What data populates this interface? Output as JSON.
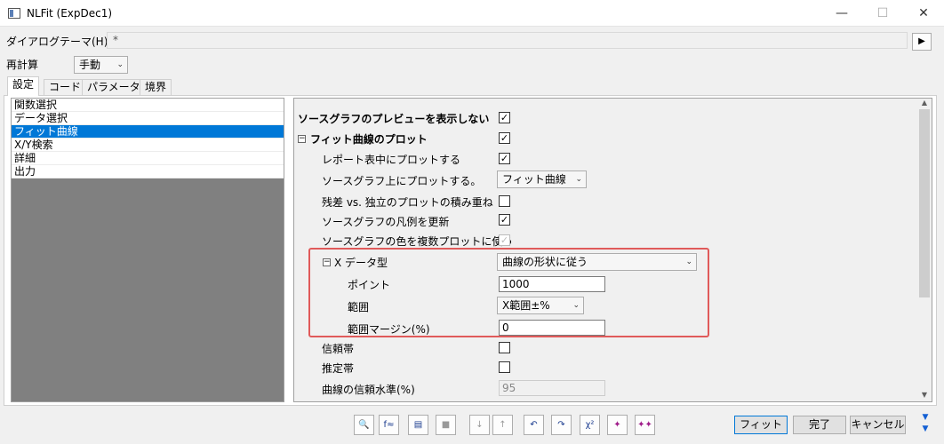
{
  "window": {
    "title": "NLFit (ExpDec1)",
    "minimize": "—",
    "maximize": "☐",
    "close": "✕"
  },
  "theme": {
    "label": "ダイアログテーマ(H)",
    "value": "*",
    "arrow": "▶"
  },
  "recalc": {
    "label": "再計算",
    "value": "手動"
  },
  "tabs": [
    "設定",
    "コード",
    "パラメータ",
    "境界"
  ],
  "left_list": [
    "関数選択",
    "データ選択",
    "フィット曲線",
    "X/Y検索",
    "詳細",
    "出力"
  ],
  "props": {
    "no_preview": "ソースグラフのプレビューを表示しない",
    "fit_plot": "フィット曲線のプロット",
    "plot_in_report": "レポート表中にプロットする",
    "plot_on_source": "ソースグラフ上にプロットする。",
    "plot_on_source_value": "フィット曲線",
    "stack_resid": "残差 vs. 独立のプロットの積み重ね",
    "update_legend": "ソースグラフの凡例を更新",
    "use_source_color": "ソースグラフの色を複数プロットに使う",
    "x_data_type": "X データ型",
    "x_data_type_value": "曲線の形状に従う",
    "points": "ポイント",
    "points_value": "1000",
    "range": "範囲",
    "range_value": "X範囲±%",
    "range_margin": "範囲マージン(%)",
    "range_margin_value": "0",
    "conf_band": "信頼帯",
    "pred_band": "推定帯",
    "conf_level": "曲線の信頼水準(%)",
    "conf_level_value": "95",
    "collapse_symbol": "−",
    "check_symbol": "✓"
  },
  "buttons": {
    "fit": "フィット",
    "done": "完了",
    "cancel": "キャンセル"
  },
  "toolbar_icons": [
    "preview-icon",
    "fit-curve-icon",
    "report-icon",
    "save-icon",
    "sort-down-icon",
    "sort-up-icon",
    "undo-icon",
    "redo-icon",
    "chi-square-icon",
    "fit-one-iter-icon",
    "fit-until-converge-icon"
  ]
}
